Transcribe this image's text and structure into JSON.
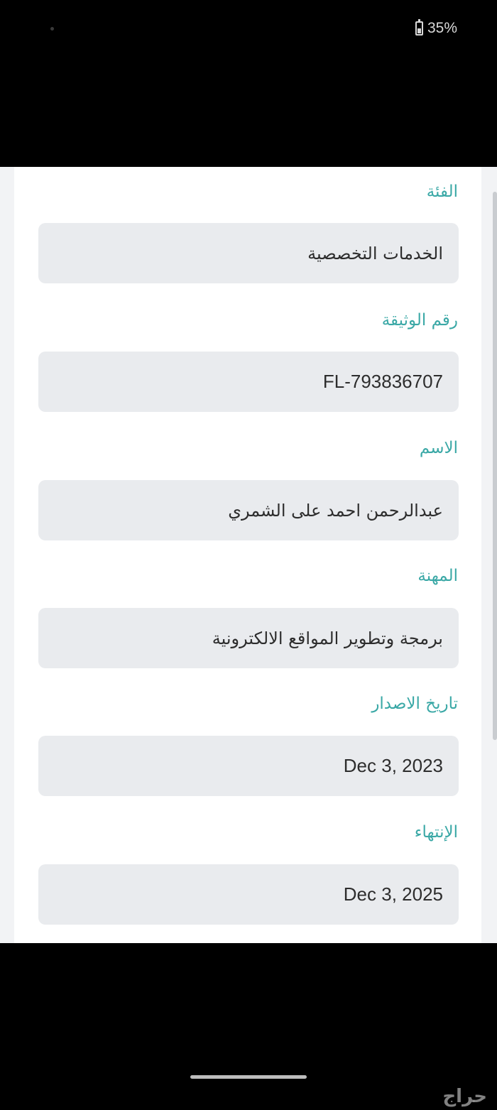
{
  "status_bar": {
    "battery_percent": "35%",
    "battery_icon": "battery-charging-icon"
  },
  "form": {
    "fields": [
      {
        "label": "الفئة",
        "value": "الخدمات التخصصية"
      },
      {
        "label": "رقم الوثيقة",
        "value": "FL-793836707"
      },
      {
        "label": "الاسم",
        "value": "عبدالرحمن احمد على الشمري"
      },
      {
        "label": "المهنة",
        "value": "برمجة وتطوير المواقع الالكترونية"
      },
      {
        "label": "تاريخ الاصدار",
        "value": "Dec 3, 2023"
      },
      {
        "label": "الإنتهاء",
        "value": "Dec 3, 2025"
      }
    ]
  },
  "watermark": "حراج",
  "colors": {
    "label": "#3aa8a6",
    "field_background": "#e9ebee",
    "value_text": "#2d2d2d"
  }
}
